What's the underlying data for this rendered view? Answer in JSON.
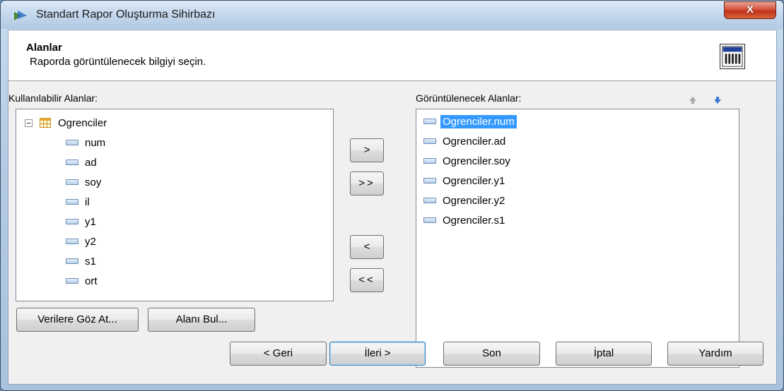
{
  "window": {
    "title": "Standart Rapor Oluşturma Sihirbazı",
    "close_label": "X"
  },
  "header": {
    "title": "Alanlar",
    "subtitle": "Raporda görüntülenecek bilgiyi seçin."
  },
  "available": {
    "label": "Kullanılabilir Alanlar:",
    "table_name": "Ogrenciler",
    "fields": [
      "num",
      "ad",
      "soy",
      "il",
      "y1",
      "y2",
      "s1",
      "ort"
    ]
  },
  "display": {
    "label": "Görüntülenecek Alanlar:",
    "fields": [
      "Ogrenciler.num",
      "Ogrenciler.ad",
      "Ogrenciler.soy",
      "Ogrenciler.y1",
      "Ogrenciler.y2",
      "Ogrenciler.s1"
    ],
    "selected_index": 0
  },
  "move_buttons": {
    "add": ">",
    "add_all": ">>",
    "remove": "<",
    "remove_all": "<<"
  },
  "tools": {
    "browse": "Verilere Göz At...",
    "find": "Alanı Bul..."
  },
  "nav": {
    "back": "< Geri",
    "next": "İleri >",
    "finish": "Son",
    "cancel": "İptal",
    "help": "Yardım"
  },
  "colors": {
    "selection": "#3399ff",
    "close_button": "#c0311b"
  }
}
